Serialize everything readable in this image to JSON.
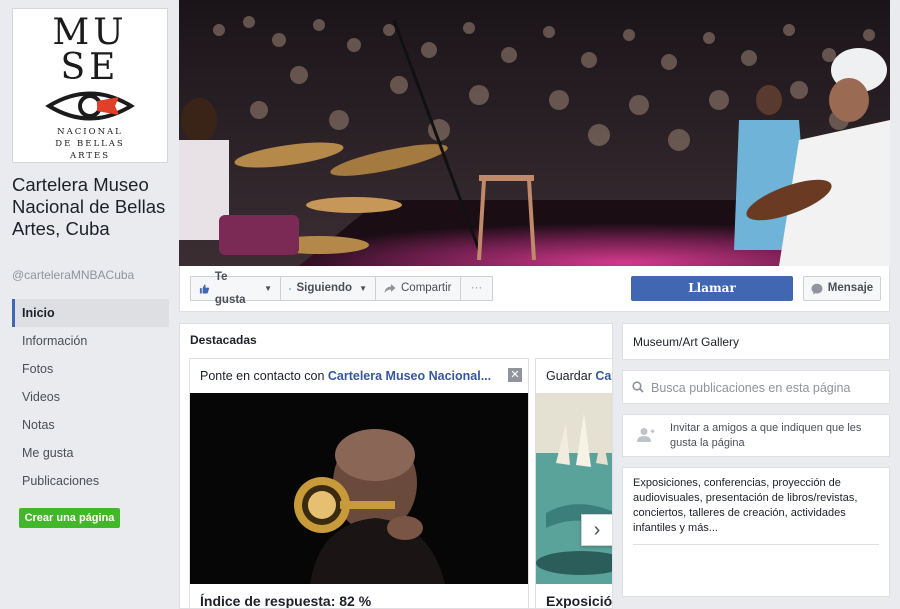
{
  "page": {
    "name": "Cartelera Museo Nacional de Bellas Artes, Cuba",
    "handle": "@carteleraMNBACuba"
  },
  "logo": {
    "line1": "MU",
    "line2": "SE",
    "sub1": "NACIONAL",
    "sub2": "DE BELLAS",
    "sub3": "ARTES"
  },
  "nav": {
    "items": [
      {
        "label": "Inicio",
        "active": true
      },
      {
        "label": "Información"
      },
      {
        "label": "Fotos"
      },
      {
        "label": "Videos"
      },
      {
        "label": "Notas"
      },
      {
        "label": "Me gusta"
      },
      {
        "label": "Publicaciones"
      }
    ]
  },
  "create_page_label": "Crear una página",
  "actions": {
    "like": "Te gusta",
    "following": "Siguiendo",
    "share": "Compartir",
    "more": "···",
    "call": "Llamar",
    "message": "Mensaje"
  },
  "featured": {
    "title": "Destacadas",
    "card1": {
      "prefix": "Ponte en contacto con ",
      "link": "Cartelera Museo Nacional...",
      "footer": "Índice de respuesta: 82 %"
    },
    "card2": {
      "prefix": "Guardar ",
      "link": "Car",
      "footer": "Exposició"
    }
  },
  "sidebar": {
    "category": "Museum/Art Gallery",
    "search_placeholder": "Busca publicaciones en esta página",
    "invite_text": "Invitar a amigos a que indiquen que les gusta la página",
    "about": "Exposiciones, conferencias, proyección de audiovisuales, presentación de libros/revistas, conciertos, talleres de creación, actividades infantiles y más..."
  },
  "colors": {
    "brand_blue": "#4267b2",
    "link_blue": "#365899",
    "green": "#42b72a",
    "logo_red": "#e0402a"
  },
  "icons": [
    "thumbs-up-icon",
    "rss-icon",
    "share-arrow-icon",
    "chevron-right-icon",
    "messenger-icon",
    "search-icon",
    "add-friend-icon",
    "close-icon"
  ]
}
